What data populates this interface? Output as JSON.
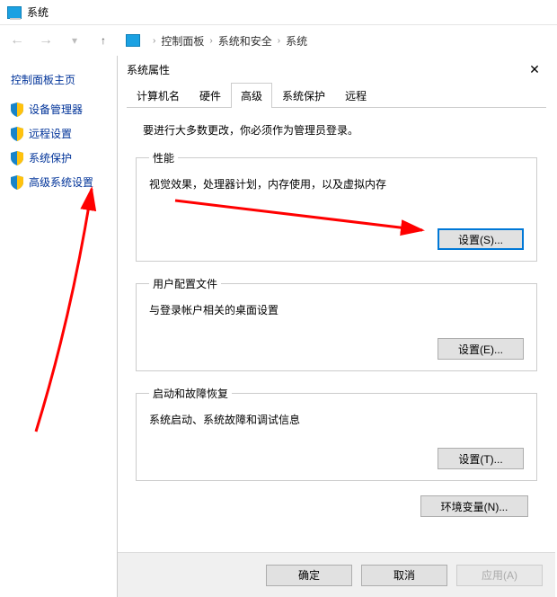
{
  "title": "系统",
  "breadcrumb": {
    "items": [
      "控制面板",
      "系统和安全",
      "系统"
    ]
  },
  "sidebar": {
    "title": "控制面板主页",
    "items": [
      {
        "label": "设备管理器"
      },
      {
        "label": "远程设置"
      },
      {
        "label": "系统保护"
      },
      {
        "label": "高级系统设置"
      }
    ]
  },
  "dialog": {
    "title": "系统属性",
    "tabs": [
      "计算机名",
      "硬件",
      "高级",
      "系统保护",
      "远程"
    ],
    "active_tab": "高级",
    "notice": "要进行大多数更改，你必须作为管理员登录。",
    "groups": {
      "performance": {
        "legend": "性能",
        "desc": "视觉效果，处理器计划，内存使用，以及虚拟内存",
        "button": "设置(S)..."
      },
      "user_profiles": {
        "legend": "用户配置文件",
        "desc": "与登录帐户相关的桌面设置",
        "button": "设置(E)..."
      },
      "startup": {
        "legend": "启动和故障恢复",
        "desc": "系统启动、系统故障和调试信息",
        "button": "设置(T)..."
      }
    },
    "env_button": "环境变量(N)...",
    "buttons": {
      "ok": "确定",
      "cancel": "取消",
      "apply": "应用(A)"
    }
  }
}
